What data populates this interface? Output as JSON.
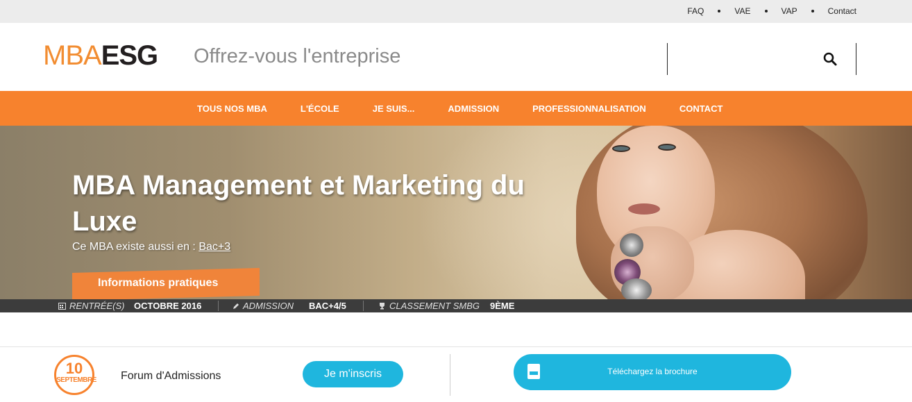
{
  "topbar": {
    "links": [
      "FAQ",
      "VAE",
      "VAP",
      "Contact"
    ]
  },
  "header": {
    "logo_part1": "MBA",
    "logo_part2": "ESG",
    "tagline": "Offrez-vous l'entreprise",
    "search_value": "",
    "search_icon": "search-icon"
  },
  "nav": {
    "items": [
      "TOUS NOS MBA",
      "L'ÉCOLE",
      "JE SUIS...",
      "ADMISSION",
      "PROFESSIONNALISATION",
      "CONTACT"
    ]
  },
  "hero": {
    "title": "MBA Management et Marketing du Luxe",
    "alt_prefix": "Ce MBA existe aussi en :",
    "alt_link": "Bac+3",
    "info_tab": "Informations pratiques"
  },
  "stats": {
    "rentree_label": "RENTRÉE(S)",
    "rentree_value": "OCTOBRE 2016",
    "admission_label": "ADMISSION",
    "admission_value": "BAC+4/5",
    "classement_label": "CLASSEMENT SMBG",
    "classement_value": "9ÈME"
  },
  "event": {
    "day": "10",
    "month": "SEPTEMBRE",
    "title": "Forum d'Admissions",
    "cta": "Je m'inscris"
  },
  "brochure": {
    "label": "Téléchargez la brochure",
    "icon": "pdf-icon"
  },
  "colors": {
    "accent": "#f7822d",
    "button": "#1fb6de",
    "stats_bar": "#3c3c3c"
  }
}
